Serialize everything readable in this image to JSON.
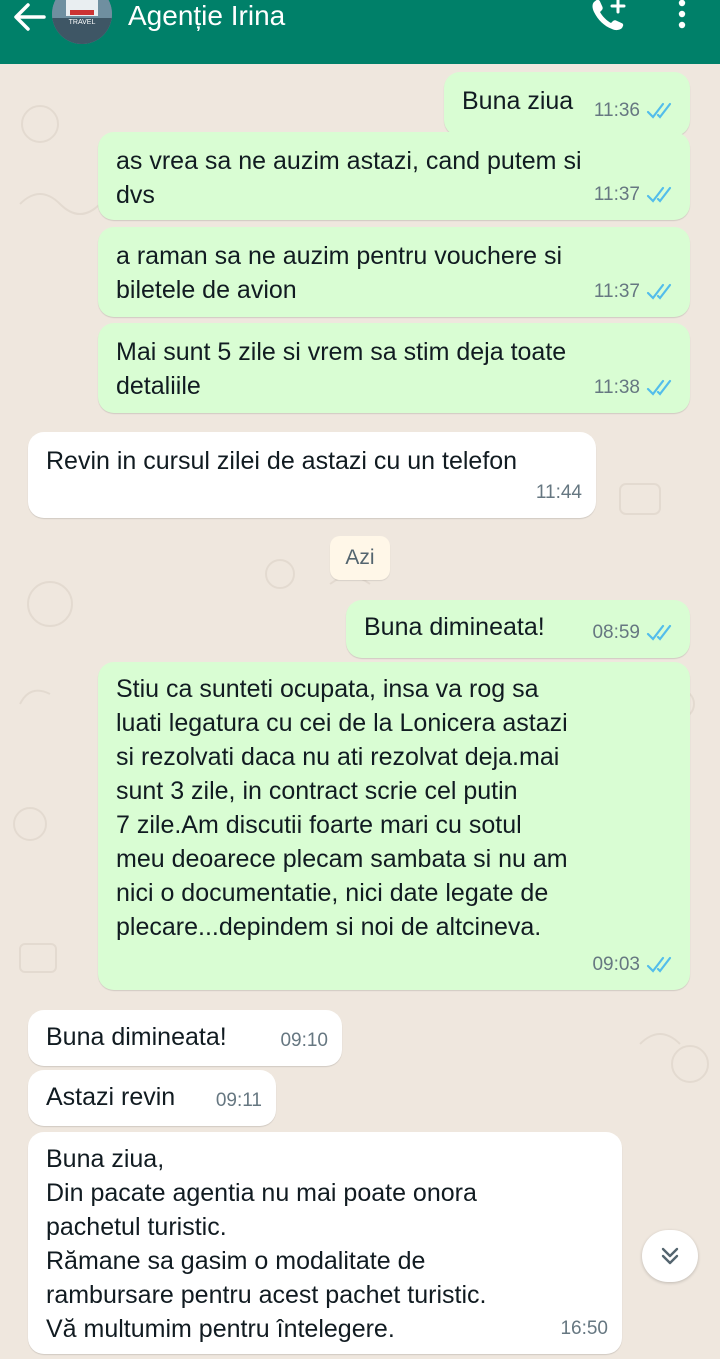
{
  "header": {
    "title": "Agenție Irina",
    "avatar_text": "TRAVEL",
    "bg_color": "#008069"
  },
  "messages": [
    {
      "dir": "out",
      "text": "Buna ziua",
      "time": "11:36",
      "ticks": "read"
    },
    {
      "dir": "out",
      "text": "as vrea sa ne auzim astazi, cand putem si\ndvs",
      "time": "11:37",
      "ticks": "read"
    },
    {
      "dir": "out",
      "text": "a raman sa ne auzim pentru vouchere si\nbiletele de avion",
      "time": "11:37",
      "ticks": "read"
    },
    {
      "dir": "out",
      "text": "Mai sunt 5 zile si vrem sa stim deja toate\ndetaliile",
      "time": "11:38",
      "ticks": "read"
    },
    {
      "dir": "in",
      "text": "Revin in cursul zilei de astazi cu un telefon",
      "time": "11:44"
    },
    {
      "dir": "out",
      "text": "Buna dimineata!",
      "time": "08:59",
      "ticks": "read"
    },
    {
      "dir": "out",
      "text": "Stiu ca sunteti ocupata, insa va rog sa\nluati legatura cu cei de la Lonicera astazi\nsi rezolvati daca nu ati rezolvat deja.mai\nsunt 3 zile, in contract scrie cel putin\n7 zile.Am discutii foarte mari cu sotul\nmeu deoarece plecam sambata si nu am\nnici o documentatie, nici date legate de\nplecare...depindem si noi de altcineva.",
      "time": "09:03",
      "ticks": "read"
    },
    {
      "dir": "in",
      "text": "Buna dimineata!",
      "time": "09:10"
    },
    {
      "dir": "in",
      "text": "Astazi revin",
      "time": "09:11"
    },
    {
      "dir": "in",
      "text": "Buna ziua,\nDin pacate agentia nu mai poate onora\npachetul turistic.\nRămane sa gasim o modalitate de\nrambursare pentru acest pachet turistic.\nVă multumim pentru întelegere.",
      "time": "16:50"
    }
  ],
  "day_separator": "Azi",
  "colors": {
    "outgoing": "#d9fdd3",
    "incoming": "#ffffff",
    "read_ticks": "#53bdeb"
  }
}
